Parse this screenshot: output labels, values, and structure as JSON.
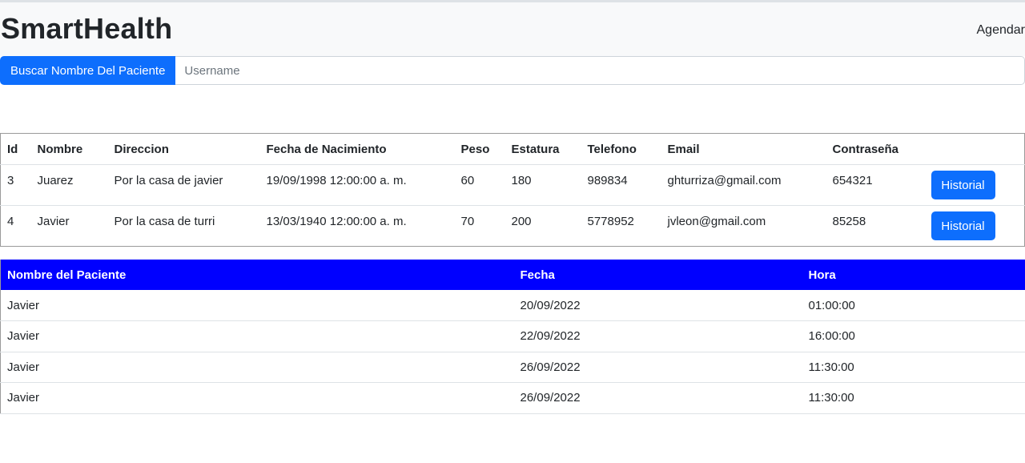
{
  "navbar": {
    "brand": "SmartHealth",
    "link": "Agendar"
  },
  "search": {
    "button_label": "Buscar Nombre Del Paciente",
    "placeholder": "Username"
  },
  "patients": {
    "headers": [
      "Id",
      "Nombre",
      "Direccion",
      "Fecha de Nacimiento",
      "Peso",
      "Estatura",
      "Telefono",
      "Email",
      "Contraseña",
      ""
    ],
    "rows": [
      {
        "id": "3",
        "nombre": "Juarez",
        "direccion": "Por la casa de javier",
        "fecha": "19/09/1998 12:00:00 a. m.",
        "peso": "60",
        "estatura": "180",
        "telefono": "989834",
        "email": "ghturriza@gmail.com",
        "contrasena": "654321",
        "button": "Historial"
      },
      {
        "id": "4",
        "nombre": "Javier",
        "direccion": "Por la casa de turri",
        "fecha": "13/03/1940 12:00:00 a. m.",
        "peso": "70",
        "estatura": "200",
        "telefono": "5778952",
        "email": "jvleon@gmail.com",
        "contrasena": "85258",
        "button": "Historial"
      }
    ]
  },
  "citas": {
    "headers": [
      "Nombre del Paciente",
      "Fecha",
      "Hora"
    ],
    "rows": [
      {
        "nombre": "Javier",
        "fecha": "20/09/2022",
        "hora": "01:00:00"
      },
      {
        "nombre": "Javier",
        "fecha": "22/09/2022",
        "hora": "16:00:00"
      },
      {
        "nombre": "Javier",
        "fecha": "26/09/2022",
        "hora": "11:30:00"
      },
      {
        "nombre": "Javier",
        "fecha": "26/09/2022",
        "hora": "11:30:00"
      }
    ]
  },
  "colors": {
    "primary": "#0d6efd",
    "table_header": "#0000ff"
  }
}
